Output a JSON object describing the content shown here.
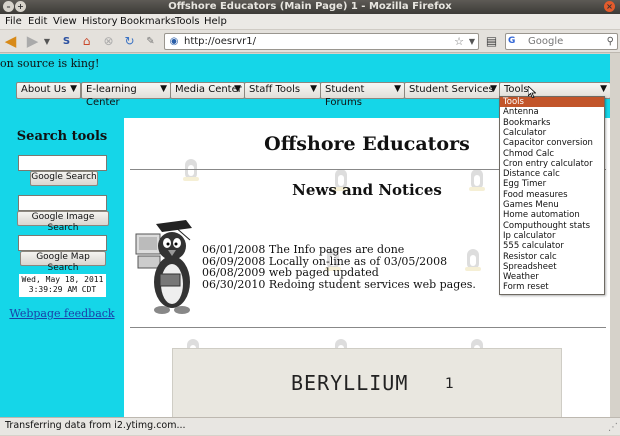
{
  "window": {
    "title": "Offshore Educators (Main Page) 1 - Mozilla Firefox"
  },
  "menubar": {
    "items": [
      "File",
      "Edit",
      "View",
      "History",
      "Bookmarks",
      "Tools",
      "Help"
    ]
  },
  "toolbar": {
    "url": "http://oesrvr1/",
    "search_placeholder": "Google",
    "search_engine": "G"
  },
  "page": {
    "marquee": "on source is king!",
    "nav_selects": [
      {
        "label": "About Us"
      },
      {
        "label": "E-learning Center"
      },
      {
        "label": "Media Center"
      },
      {
        "label": "Staff Tools"
      },
      {
        "label": "Student Forums"
      },
      {
        "label": "Student Services"
      },
      {
        "label": "Tools"
      }
    ],
    "sidebar": {
      "heading": "Search tools",
      "google_search_button": "Google Search",
      "google_image_search_button": "Google Image Search",
      "google_map_search_button": "Google Map Search",
      "clock_line1": "Wed, May 18, 2011",
      "clock_line2": "3:39:29 AM CDT",
      "feedback_link": "Webpage feedback"
    },
    "title": "Offshore Educators",
    "news_heading": "News and Notices",
    "news": [
      "06/01/2008 The Info pages are done",
      "06/09/2008 Locally on-line as of 03/05/2008",
      "06/08/2009 web paged updated",
      "06/30/2010 Redoing student services web pages."
    ],
    "image_text": "BERYLLIUM",
    "image_number": "1"
  },
  "tools_dropdown": {
    "options": [
      "Tools",
      "Antenna",
      "Bookmarks",
      "Calculator",
      "Capacitor conversion",
      "Chmod Calc",
      "Cron entry calculator",
      "Distance calc",
      "Egg Timer",
      "Food measures",
      "Games Menu",
      "Home automation",
      "Computhought stats",
      "Ip calculator",
      "555 calculator",
      "Resistor calc",
      "Spreadsheet",
      "Weather",
      "Form reset"
    ],
    "selected": "Tools"
  },
  "statusbar": {
    "text": "Transferring data from i2.ytimg.com..."
  },
  "colors": {
    "page_accent": "#15d6e8",
    "dropdown_selected": "#c2552a",
    "link": "#1a3fa8"
  }
}
